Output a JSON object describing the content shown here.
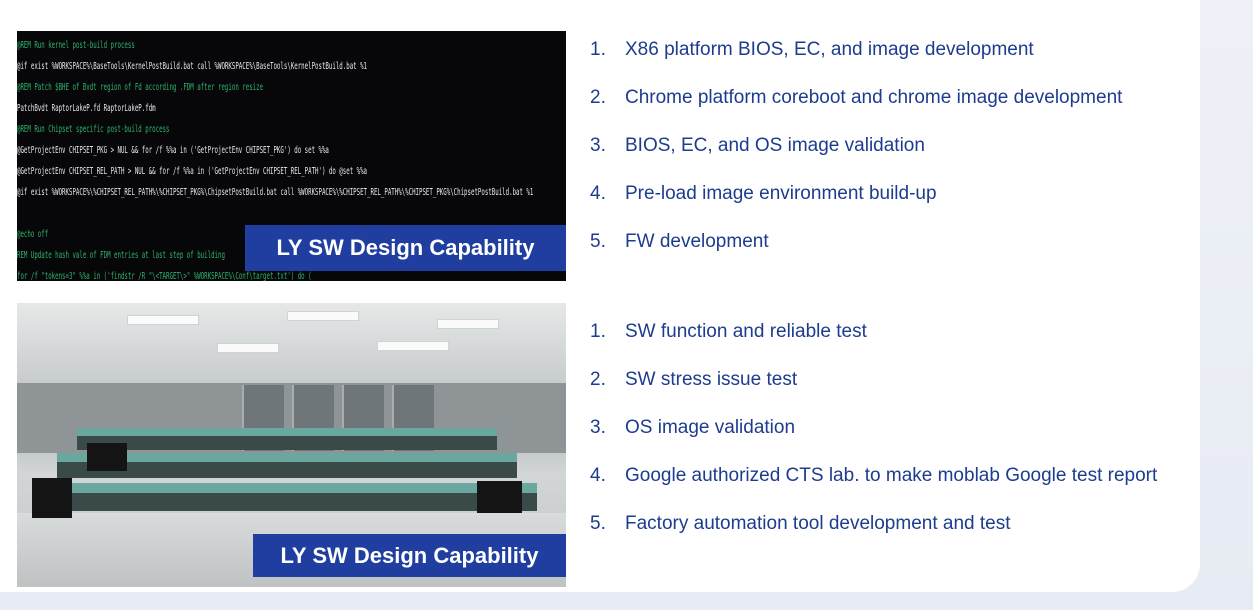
{
  "code_panel": {
    "lines": [
      {
        "text": "@REM Run kernel post-build process",
        "type": "comment"
      },
      {
        "text": "@if exist %WORKSPACE%\\BaseTools\\KernelPostBuild.bat call %WORKSPACE%\\BaseTools\\KernelPostBuild.bat %1",
        "type": "cmd"
      },
      {
        "text": "@REM Patch $BHE of Bvdt region of Fd according .FDM after region resize",
        "type": "comment"
      },
      {
        "text": "PatchBvdt RaptorLakeP.fd RaptorLakeP.fdm",
        "type": "cmd"
      },
      {
        "text": "@REM Run Chipset specific post-build process",
        "type": "comment"
      },
      {
        "text": "@GetProjectEnv CHIPSET_PKG > NUL && for /f %%a in ('GetProjectEnv CHIPSET_PKG') do set %%a",
        "type": "cmd"
      },
      {
        "text": "@GetProjectEnv CHIPSET_REL_PATH > NUL && for /f %%a in ('GetProjectEnv CHIPSET_REL_PATH') do @set %%a",
        "type": "cmd"
      },
      {
        "text": "@if exist %WORKSPACE%\\%CHIPSET_REL_PATH%\\%CHIPSET_PKG%\\ChipsetPostBuild.bat call %WORKSPACE%\\%CHIPSET_REL_PATH%\\%CHIPSET_PKG%\\ChipsetPostBuild.bat %1",
        "type": "cmd"
      },
      {
        "text": "",
        "type": "cmd"
      },
      {
        "text": "@echo off",
        "type": "comment"
      },
      {
        "text": "REM Update hash vale of FDM entries at last step of building",
        "type": "comment"
      },
      {
        "text": "for /f \"tokens=3\" %%a in ('findstr /R \"\\<TARGET\\>\" %WORKSPACE%\\Conf\\target.txt') do (",
        "type": "comment"
      }
    ],
    "caption": "LY SW Design Capability"
  },
  "lab_panel": {
    "caption": "LY SW Design Capability"
  },
  "capabilities_list": [
    {
      "num": "1.",
      "text": "X86 platform BIOS, EC, and image development"
    },
    {
      "num": "2.",
      "text": "Chrome platform coreboot and chrome image development"
    },
    {
      "num": "3.",
      "text": "BIOS, EC, and OS image validation"
    },
    {
      "num": "4.",
      "text": "Pre-load image environment build-up"
    },
    {
      "num": "5.",
      "text": "FW development"
    }
  ],
  "test_list": [
    {
      "num": "1.",
      "text": "SW function and reliable test"
    },
    {
      "num": "2.",
      "text": "SW stress issue test"
    },
    {
      "num": "3.",
      "text": "OS image validation"
    },
    {
      "num": "4.",
      "text": "Google authorized CTS lab. to make moblab Google test report"
    },
    {
      "num": "5.",
      "text": "Factory automation tool development and test"
    }
  ],
  "colors": {
    "accent": "#1f3ea0",
    "list_text": "#1d3c8f",
    "comment_green": "#2db36a"
  }
}
